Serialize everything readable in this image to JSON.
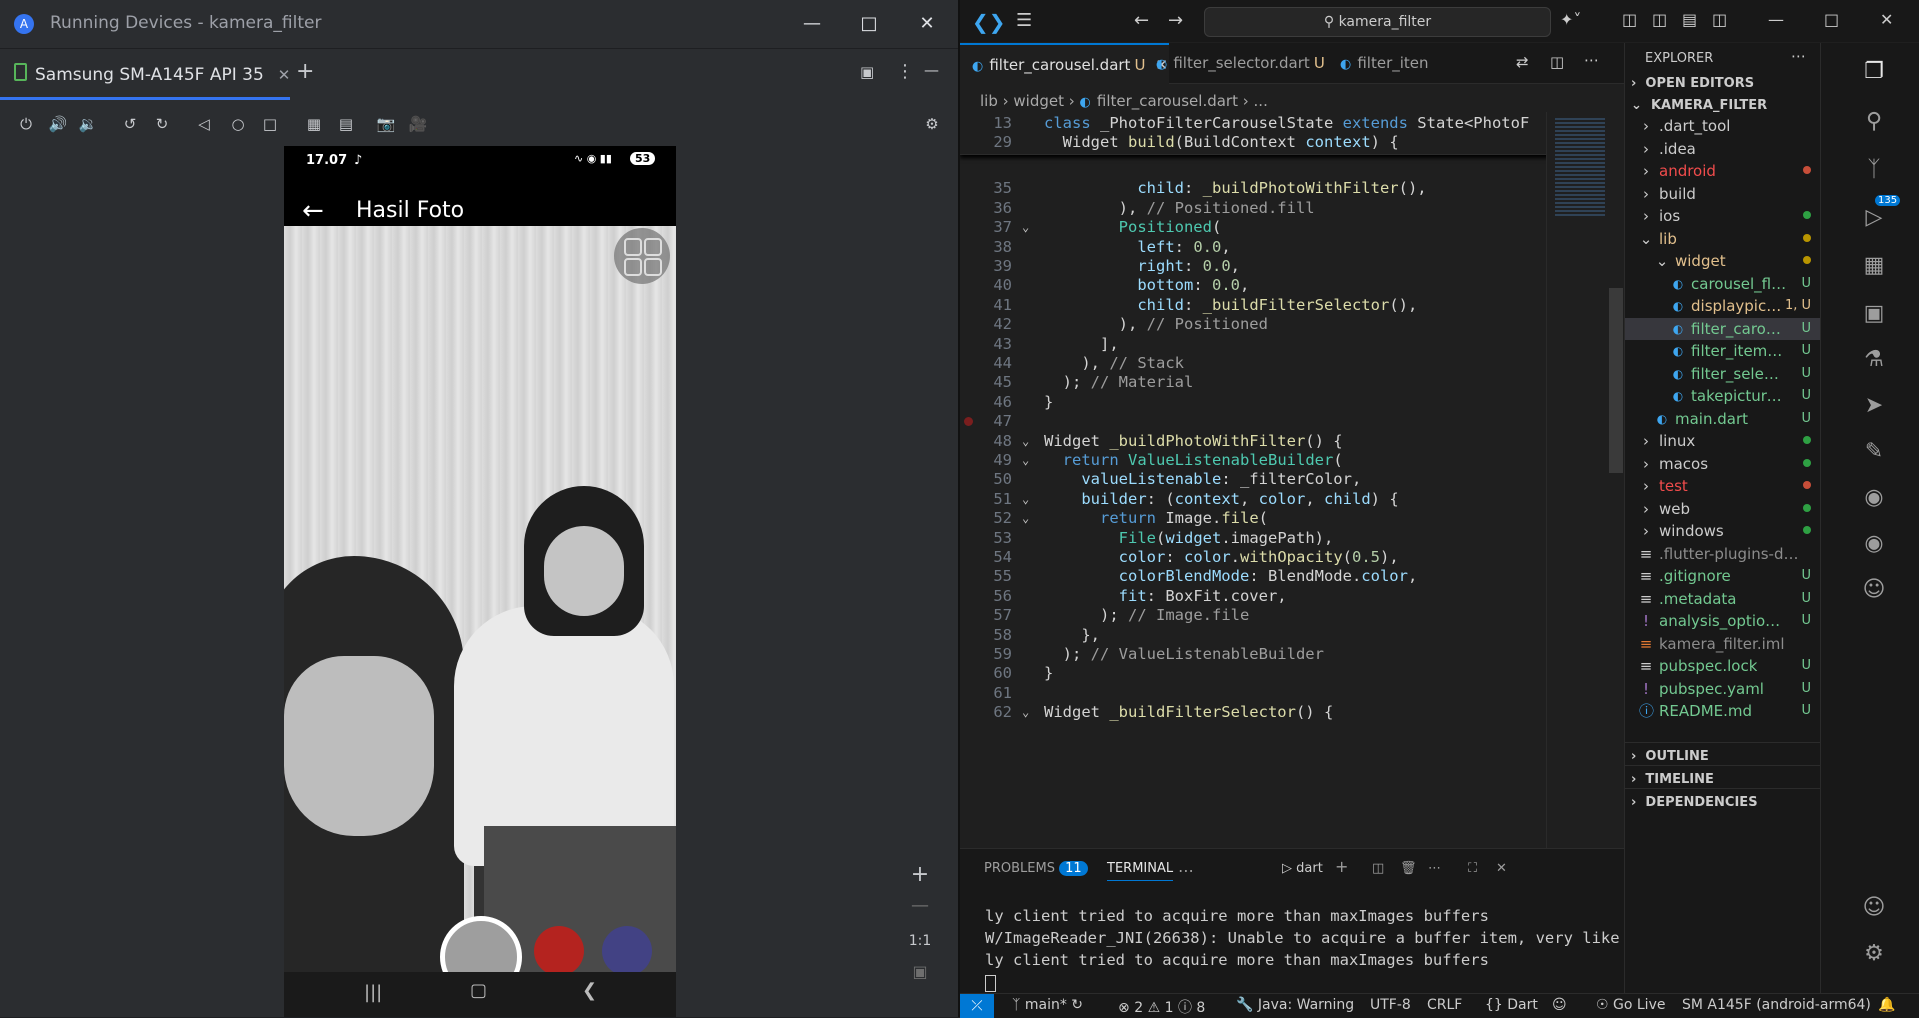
{
  "left_window": {
    "title": "Running Devices - kamera_filter",
    "device_tab": "Samsung SM-A145F API 35",
    "zoom_label": "1:1"
  },
  "phone": {
    "time": "17.07",
    "battery": "53",
    "app_title": "Hasil Foto"
  },
  "vscode": {
    "search": "kamera_filter",
    "tabs": [
      {
        "label": "filter_carousel.dart",
        "badge": "U"
      },
      {
        "label": "filter_selector.dart",
        "badge": "U"
      },
      {
        "label": "filter_iten",
        "badge": ""
      }
    ],
    "breadcrumb": [
      "lib",
      "widget",
      "filter_carousel.dart",
      "..."
    ],
    "panel": {
      "problems_label": "PROBLEMS",
      "problems_count": "11",
      "terminal_label": "TERMINAL",
      "shell": "dart",
      "lines": [
        "ly client tried to acquire more than maxImages buffers",
        "W/ImageReader_JNI(26638): Unable to acquire a buffer item, very like",
        "ly client tried to acquire more than maxImages buffers"
      ]
    },
    "explorer": {
      "title": "EXPLORER",
      "open_editors": "OPEN EDITORS",
      "project": "KAMERA_FILTER",
      "outline": "OUTLINE",
      "timeline": "TIMELINE",
      "dependencies": "DEPENDENCIES"
    },
    "status": {
      "branch": "main*",
      "errors": "2",
      "warnings": "1",
      "info": "8",
      "java": "Java: Warning",
      "encoding": "UTF-8",
      "eol": "CRLF",
      "lang": "Dart",
      "golive": "Go Live",
      "device": "SM A145F (android-arm64)"
    },
    "scm_badge": "135"
  },
  "code_lines": [
    {
      "n": "13",
      "t": "class _PhotoFilterCarouselState extends State<PhotoF"
    },
    {
      "n": "29",
      "t": "  Widget build(BuildContext context) {"
    },
    {
      "n": "35",
      "t": "          child: _buildPhotoWithFilter(),"
    },
    {
      "n": "36",
      "t": "        ), // Positioned.fill"
    },
    {
      "n": "37",
      "t": "        Positioned("
    },
    {
      "n": "38",
      "t": "          left: 0.0,"
    },
    {
      "n": "39",
      "t": "          right: 0.0,"
    },
    {
      "n": "40",
      "t": "          bottom: 0.0,"
    },
    {
      "n": "41",
      "t": "          child: _buildFilterSelector(),"
    },
    {
      "n": "42",
      "t": "        ), // Positioned"
    },
    {
      "n": "43",
      "t": "      ],"
    },
    {
      "n": "44",
      "t": "    ), // Stack"
    },
    {
      "n": "45",
      "t": "  ); // Material"
    },
    {
      "n": "46",
      "t": "}"
    },
    {
      "n": "47",
      "t": ""
    },
    {
      "n": "48",
      "t": "Widget _buildPhotoWithFilter() {"
    },
    {
      "n": "49",
      "t": "  return ValueListenableBuilder("
    },
    {
      "n": "50",
      "t": "    valueListenable: _filterColor,"
    },
    {
      "n": "51",
      "t": "    builder: (context, color, child) {"
    },
    {
      "n": "52",
      "t": "      return Image.file("
    },
    {
      "n": "53",
      "t": "        File(widget.imagePath),"
    },
    {
      "n": "54",
      "t": "        color: color.withOpacity(0.5),"
    },
    {
      "n": "55",
      "t": "        colorBlendMode: BlendMode.color,"
    },
    {
      "n": "56",
      "t": "        fit: BoxFit.cover,"
    },
    {
      "n": "57",
      "t": "      ); // Image.file"
    },
    {
      "n": "58",
      "t": "    },"
    },
    {
      "n": "59",
      "t": "  ); // ValueListenableBuilder"
    },
    {
      "n": "60",
      "t": "}"
    },
    {
      "n": "61",
      "t": ""
    },
    {
      "n": "62",
      "t": "Widget _buildFilterSelector() {"
    }
  ],
  "explorer_items": [
    {
      "label": ".dart_tool",
      "kind": "folder",
      "depth": 0,
      "status": "",
      "color": "#cccccc",
      "dot": ""
    },
    {
      "label": ".idea",
      "kind": "folder",
      "depth": 0,
      "status": "",
      "color": "#cccccc",
      "dot": ""
    },
    {
      "label": "android",
      "kind": "folder",
      "depth": 0,
      "status": "",
      "color": "#f14c4c",
      "dot": "#c74e39"
    },
    {
      "label": "build",
      "kind": "folder",
      "depth": 0,
      "status": "",
      "color": "#cccccc",
      "dot": ""
    },
    {
      "label": "ios",
      "kind": "folder",
      "depth": 0,
      "status": "",
      "color": "#cccccc",
      "dot": "#2ea043"
    },
    {
      "label": "lib",
      "kind": "folder-open",
      "depth": 0,
      "status": "",
      "color": "#e2c08d",
      "dot": "#b89500"
    },
    {
      "label": "widget",
      "kind": "folder-open",
      "depth": 1,
      "status": "",
      "color": "#e2c08d",
      "dot": "#b89500"
    },
    {
      "label": "carousel_flowdele...",
      "kind": "dart",
      "depth": 2,
      "status": "U",
      "color": "#73c991",
      "dot": ""
    },
    {
      "label": "displaypicture_s...",
      "kind": "dart",
      "depth": 2,
      "status": "1, U",
      "color": "#e2c08d",
      "dot": ""
    },
    {
      "label": "filter_carousel.dart",
      "kind": "dart",
      "depth": 2,
      "status": "U",
      "color": "#73c991",
      "dot": "",
      "selected": "true"
    },
    {
      "label": "filter_item.dart",
      "kind": "dart",
      "depth": 2,
      "status": "U",
      "color": "#73c991",
      "dot": ""
    },
    {
      "label": "filter_selector.dart",
      "kind": "dart",
      "depth": 2,
      "status": "U",
      "color": "#73c991",
      "dot": ""
    },
    {
      "label": "takepicture_scree...",
      "kind": "dart",
      "depth": 2,
      "status": "U",
      "color": "#73c991",
      "dot": ""
    },
    {
      "label": "main.dart",
      "kind": "dart",
      "depth": 1,
      "status": "U",
      "color": "#73c991",
      "dot": ""
    },
    {
      "label": "linux",
      "kind": "folder",
      "depth": 0,
      "status": "",
      "color": "#cccccc",
      "dot": "#2ea043"
    },
    {
      "label": "macos",
      "kind": "folder",
      "depth": 0,
      "status": "",
      "color": "#cccccc",
      "dot": "#2ea043"
    },
    {
      "label": "test",
      "kind": "folder",
      "depth": 0,
      "status": "",
      "color": "#f14c4c",
      "dot": "#c74e39"
    },
    {
      "label": "web",
      "kind": "folder",
      "depth": 0,
      "status": "",
      "color": "#cccccc",
      "dot": "#2ea043"
    },
    {
      "label": "windows",
      "kind": "folder",
      "depth": 0,
      "status": "",
      "color": "#cccccc",
      "dot": "#2ea043"
    },
    {
      "label": ".flutter-plugins-depende...",
      "kind": "file",
      "depth": 0,
      "status": "",
      "color": "#8c8c8c",
      "dot": ""
    },
    {
      "label": ".gitignore",
      "kind": "file",
      "depth": 0,
      "status": "U",
      "color": "#73c991",
      "dot": ""
    },
    {
      "label": ".metadata",
      "kind": "file",
      "depth": 0,
      "status": "U",
      "color": "#73c991",
      "dot": ""
    },
    {
      "label": "analysis_options.yaml",
      "kind": "yaml",
      "depth": 0,
      "status": "U",
      "color": "#73c991",
      "dot": ""
    },
    {
      "label": "kamera_filter.iml",
      "kind": "rss",
      "depth": 0,
      "status": "",
      "color": "#8c8c8c",
      "dot": ""
    },
    {
      "label": "pubspec.lock",
      "kind": "file",
      "depth": 0,
      "status": "U",
      "color": "#73c991",
      "dot": ""
    },
    {
      "label": "pubspec.yaml",
      "kind": "yaml",
      "depth": 0,
      "status": "U",
      "color": "#73c991",
      "dot": ""
    },
    {
      "label": "README.md",
      "kind": "info",
      "depth": 0,
      "status": "U",
      "color": "#73c991",
      "dot": ""
    }
  ]
}
